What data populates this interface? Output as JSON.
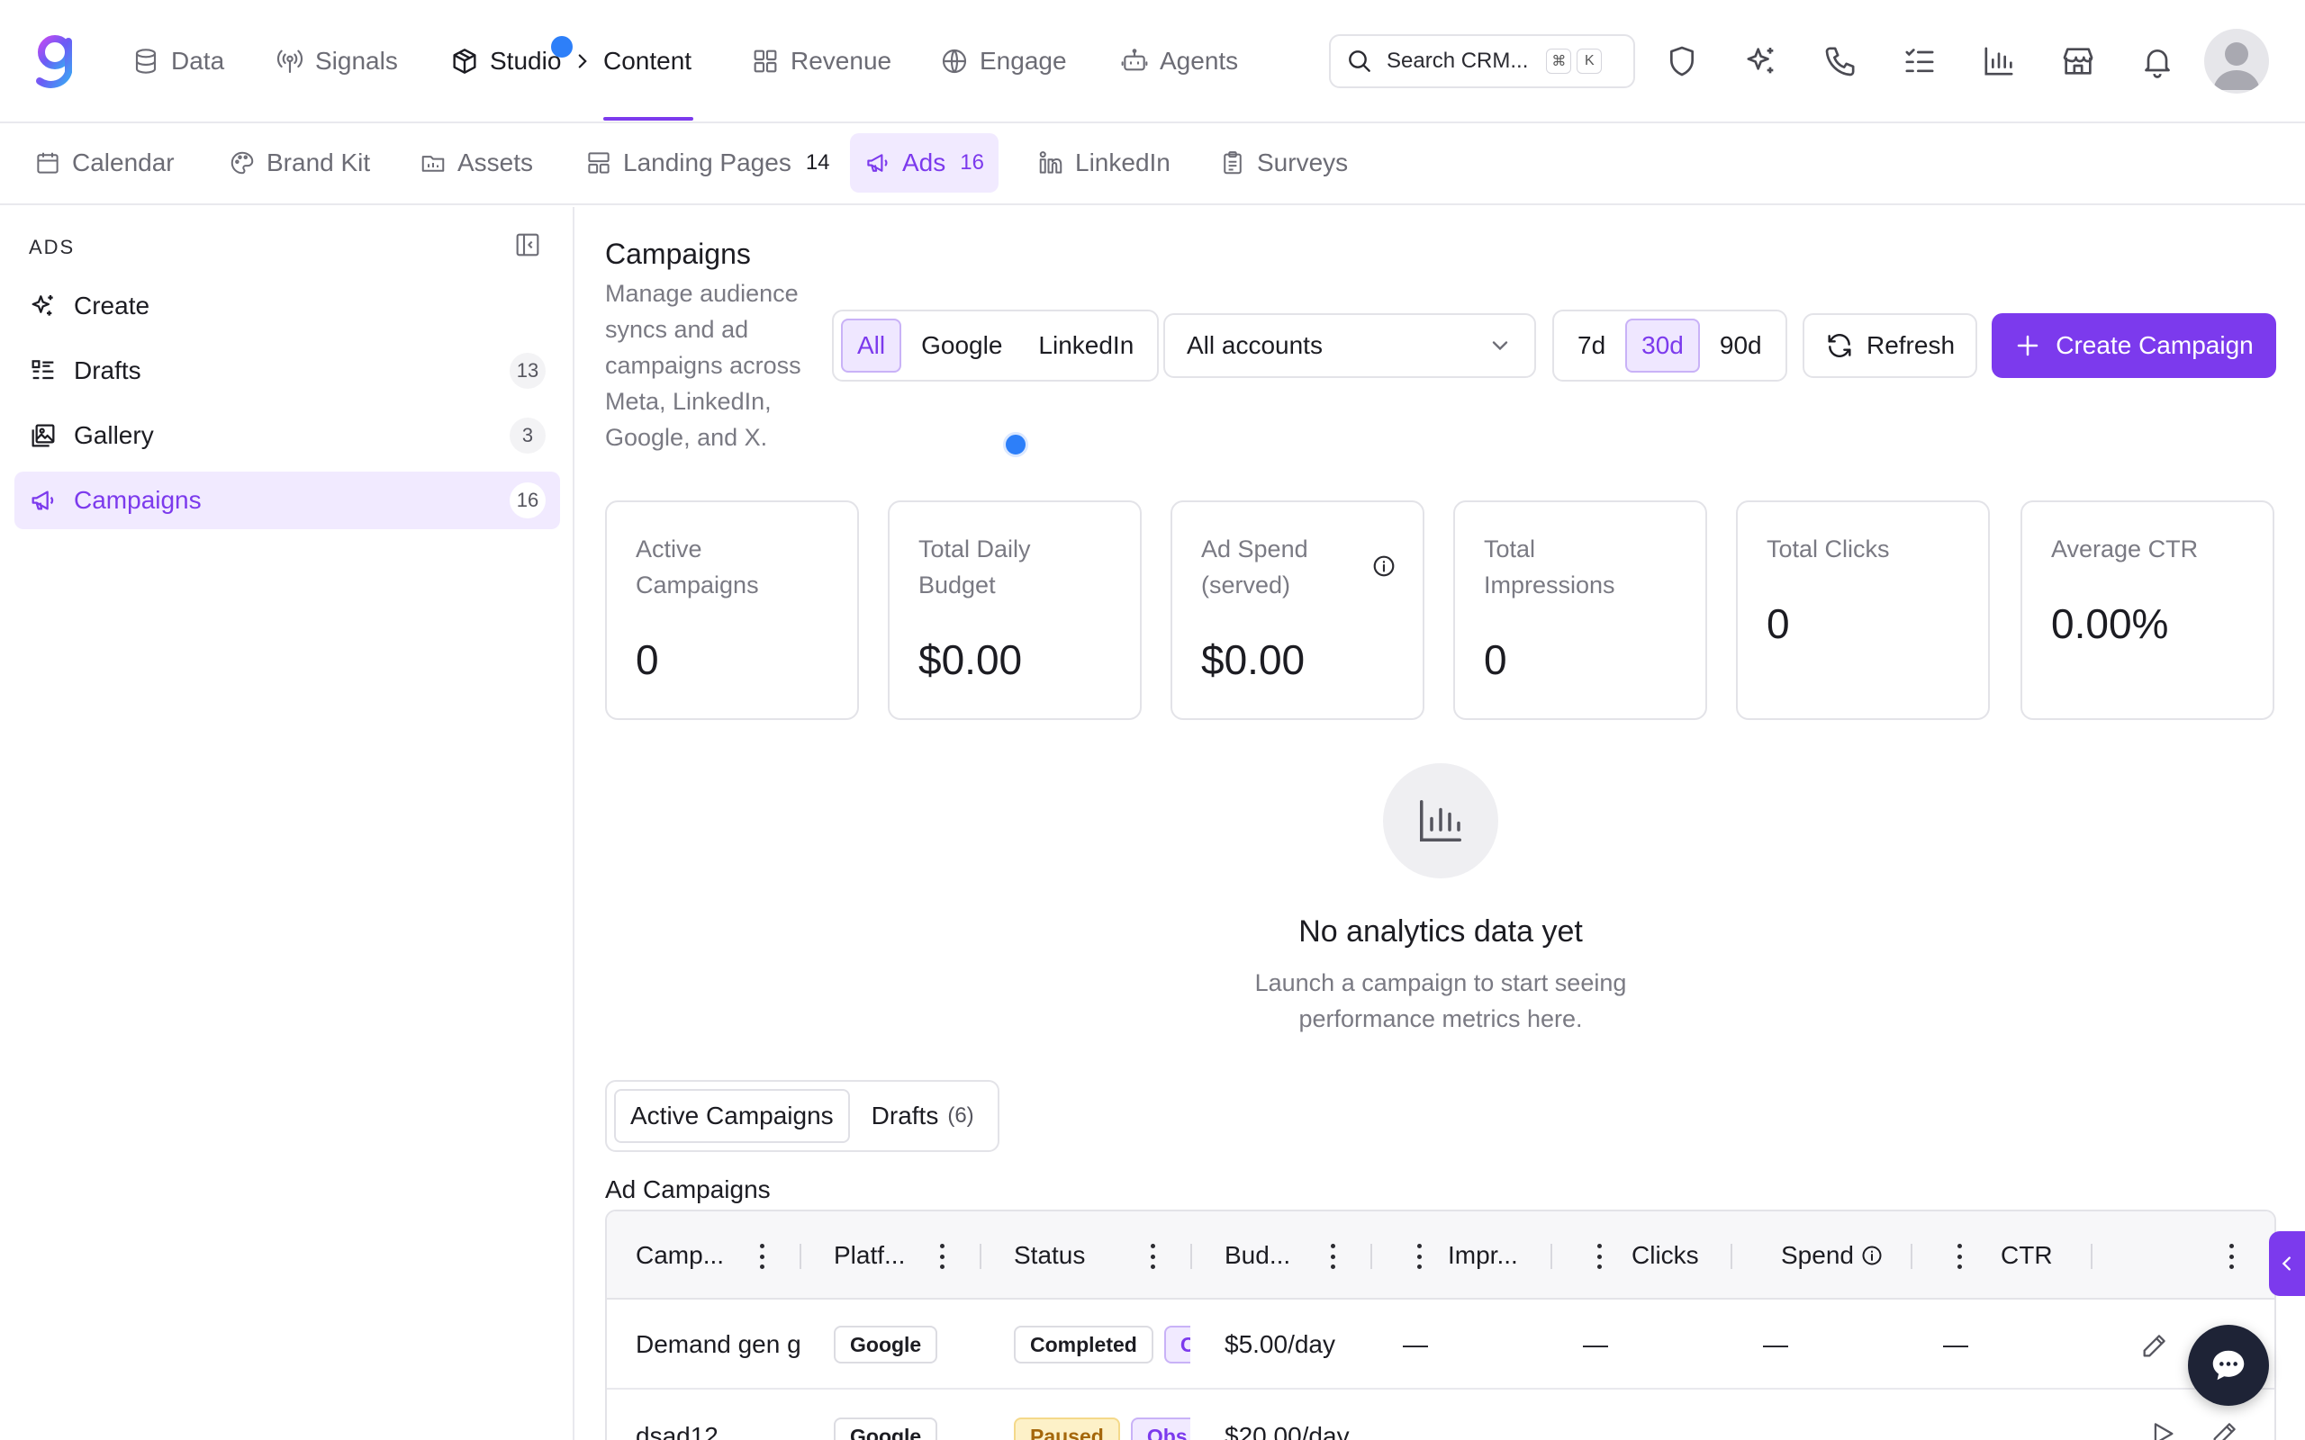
{
  "nav": {
    "items": [
      {
        "label": "Data",
        "icon": "database-icon"
      },
      {
        "label": "Signals",
        "icon": "signal-icon"
      },
      {
        "label": "Studio",
        "icon": "cube-icon"
      },
      {
        "label": "Content",
        "icon": "none"
      },
      {
        "label": "Revenue",
        "icon": "grid-icon"
      },
      {
        "label": "Engage",
        "icon": "globe-icon"
      },
      {
        "label": "Agents",
        "icon": "robot-icon"
      }
    ],
    "search_placeholder": "Search CRM...",
    "shortcut": [
      "⌘",
      "K"
    ]
  },
  "subnav": {
    "items": [
      {
        "label": "Calendar",
        "count": ""
      },
      {
        "label": "Brand Kit",
        "count": ""
      },
      {
        "label": "Assets",
        "count": ""
      },
      {
        "label": "Landing Pages",
        "count": "14"
      },
      {
        "label": "Ads",
        "count": "16"
      },
      {
        "label": "LinkedIn",
        "count": ""
      },
      {
        "label": "Surveys",
        "count": ""
      }
    ]
  },
  "sidebar": {
    "title": "ADS",
    "items": [
      {
        "label": "Create",
        "count": ""
      },
      {
        "label": "Drafts",
        "count": "13"
      },
      {
        "label": "Gallery",
        "count": "3"
      },
      {
        "label": "Campaigns",
        "count": "16"
      }
    ]
  },
  "main": {
    "title": "Campaigns",
    "description": "Manage audience syncs and ad campaigns across Meta, LinkedIn, Google, and X.",
    "platform_filter": [
      "All",
      "Google",
      "LinkedIn"
    ],
    "account_select": "All accounts",
    "ranges": [
      "7d",
      "30d",
      "90d"
    ],
    "refresh_label": "Refresh",
    "create_label": "Create Campaign",
    "stats": [
      {
        "label": "Active Campaigns",
        "value": "0"
      },
      {
        "label": "Total Daily Budget",
        "value": "$0.00"
      },
      {
        "label": "Ad Spend (served)",
        "value": "$0.00"
      },
      {
        "label": "Total Impressions",
        "value": "0"
      },
      {
        "label": "Total Clicks",
        "value": "0"
      },
      {
        "label": "Average CTR",
        "value": "0.00%"
      }
    ],
    "empty": {
      "title": "No analytics data yet",
      "subtitle": "Launch a campaign to start seeing performance metrics here."
    },
    "tabs": [
      {
        "label": "Active Campaigns",
        "count": ""
      },
      {
        "label": "Drafts",
        "count": "(6)"
      }
    ],
    "table": {
      "title": "Ad Campaigns",
      "headers": [
        "Camp...",
        "Platf...",
        "Status",
        "Bud...",
        "Impr...",
        "Clicks",
        "Spend",
        "CTR"
      ],
      "rows": [
        {
          "name": "Demand gen g",
          "platform": "Google",
          "status": "Completed",
          "status2": "O",
          "budget": "$5.00/day",
          "impressions": "—",
          "clicks": "—",
          "spend": "—",
          "ctr": "—"
        },
        {
          "name": "dsad12",
          "platform": "Google",
          "status": "Paused",
          "status2": "Obs",
          "budget": "$20.00/day",
          "impressions": "",
          "clicks": "",
          "spend": "",
          "ctr": ""
        }
      ]
    }
  },
  "colors": {
    "accent": "#7c3aed",
    "accent_bg": "#f1eaff",
    "dot": "#2d7ff9"
  }
}
